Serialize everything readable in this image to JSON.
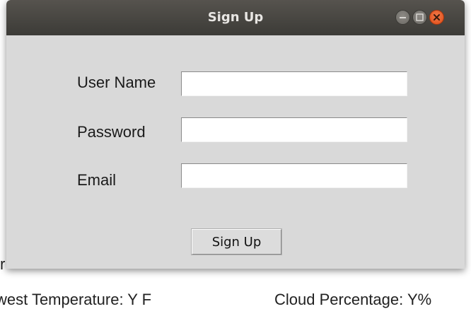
{
  "background": {
    "fragment_left": "r",
    "text_lowest_temp": "west Temperature: Y F",
    "text_cloud": "Cloud Percentage: Y%"
  },
  "window": {
    "title": "Sign Up",
    "controls": {
      "minimize_icon": "minimize-icon",
      "maximize_icon": "maximize-icon",
      "close_icon": "close-icon"
    }
  },
  "form": {
    "username_label": "User Name",
    "username_value": "",
    "password_label": "Password",
    "password_value": "",
    "email_label": "Email",
    "email_value": "",
    "submit_label": "Sign Up"
  },
  "colors": {
    "titlebar": "#3c3b37",
    "window_bg": "#d9d9d9",
    "close_button": "#df4b16"
  }
}
